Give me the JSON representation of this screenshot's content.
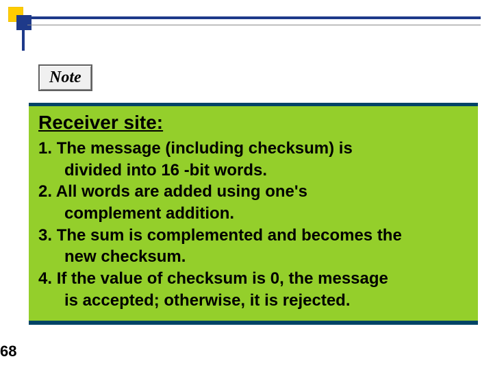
{
  "note_label": "Note",
  "title": "Receiver site:",
  "items": [
    {
      "num": "1.",
      "first": "The message (including checksum) is",
      "cont": "divided into 16 -bit words."
    },
    {
      "num": "2.",
      "first": "All words are added using one's",
      "cont": "complement addition."
    },
    {
      "num": "3.",
      "first": "The sum is complemented and becomes the",
      "cont": "new checksum."
    },
    {
      "num": "4.",
      "first": "If the value of checksum is 0, the message",
      "cont": "is accepted; otherwise, it is rejected."
    }
  ],
  "page_number": "68"
}
